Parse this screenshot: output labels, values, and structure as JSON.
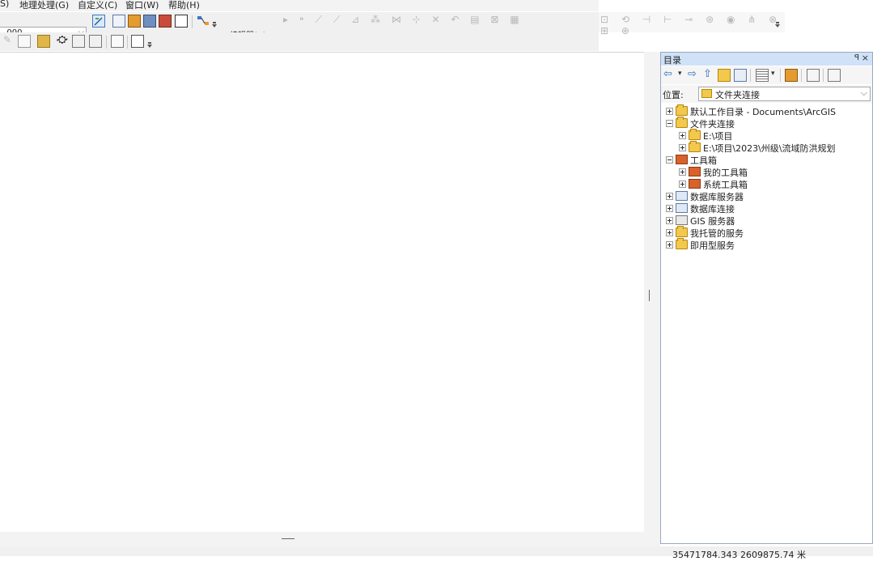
{
  "menu": {
    "items": [
      "S)",
      "地理处理(G)",
      "自定义(C)",
      "窗口(W)",
      "帮助(H)"
    ]
  },
  "toolbar": {
    "scale_value": ", 000",
    "editor_label": "编辑器(R)▾"
  },
  "catalog": {
    "title": "目录",
    "pin_glyph": "ꟼ",
    "close_glyph": "×",
    "location_label": "位置:",
    "location_value": "文件夹连接",
    "tree": [
      {
        "label": "默认工作目录 - Documents\\ArcGIS",
        "level": 0,
        "expanded": false,
        "icon": "folder-home-icon"
      },
      {
        "label": "文件夹连接",
        "level": 0,
        "expanded": true,
        "icon": "folder-connections-icon"
      },
      {
        "label": "E:\\项目",
        "level": 1,
        "expanded": false,
        "icon": "folder-icon"
      },
      {
        "label": "E:\\项目\\2023\\州级\\流域防洪规划",
        "level": 1,
        "expanded": false,
        "icon": "folder-icon"
      },
      {
        "label": "工具箱",
        "level": 0,
        "expanded": true,
        "icon": "toolboxes-icon"
      },
      {
        "label": "我的工具箱",
        "level": 1,
        "expanded": false,
        "icon": "toolbox-icon"
      },
      {
        "label": "系统工具箱",
        "level": 1,
        "expanded": false,
        "icon": "toolbox-icon"
      },
      {
        "label": "数据库服务器",
        "level": 0,
        "expanded": false,
        "icon": "database-server-icon"
      },
      {
        "label": "数据库连接",
        "level": 0,
        "expanded": false,
        "icon": "database-connection-icon"
      },
      {
        "label": "GIS 服务器",
        "level": 0,
        "expanded": false,
        "icon": "gis-server-icon"
      },
      {
        "label": "我托管的服务",
        "level": 0,
        "expanded": false,
        "icon": "hosted-services-icon"
      },
      {
        "label": "即用型服务",
        "level": 0,
        "expanded": false,
        "icon": "ready-services-icon"
      }
    ]
  },
  "status": {
    "coordinates": "35471784.343  2609875.74 米"
  },
  "colors": {
    "catalog_title_bg": "#cfe2f7",
    "folder": "#f2c94c",
    "toolbox": "#d9622b"
  }
}
